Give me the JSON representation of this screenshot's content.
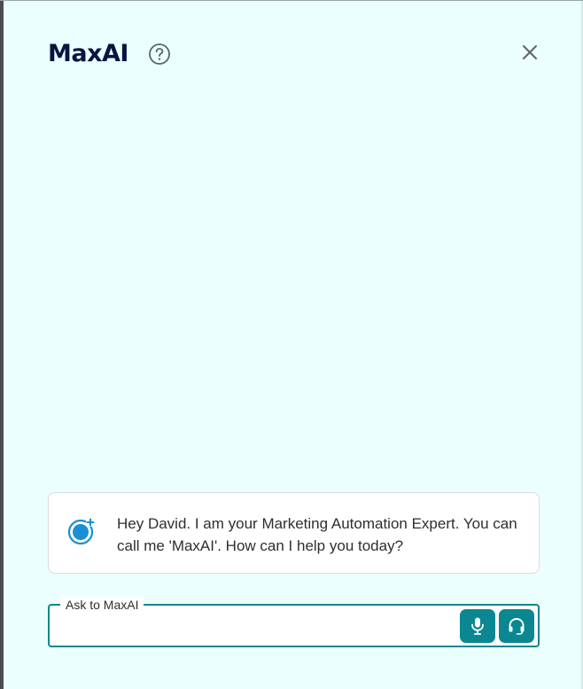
{
  "header": {
    "title": "MaxAI",
    "help_icon": "help-circle-icon",
    "close_icon": "close-icon"
  },
  "message": {
    "avatar_icon": "bot-avatar-icon",
    "text": "Hey David. I am your Marketing Automation Expert. You can call me 'MaxAI'. How can I help you today?"
  },
  "input": {
    "label": "Ask to MaxAI",
    "value": "",
    "placeholder": "",
    "mic_icon": "microphone-icon",
    "agent_icon": "headset-icon"
  },
  "colors": {
    "background": "#ebfffe",
    "accent": "#0a8790",
    "title": "#0b1440",
    "avatar": "#1a8fd6"
  }
}
